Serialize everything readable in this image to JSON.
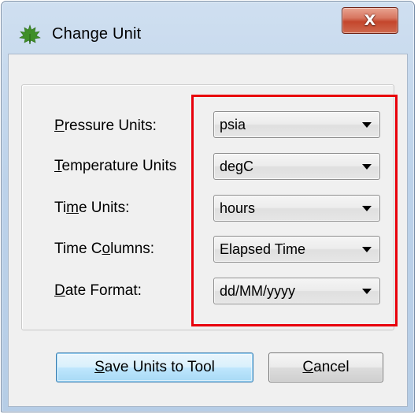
{
  "window": {
    "title": "Change Unit",
    "close_symbol": "X",
    "app_icon": "leaf-icon"
  },
  "fields": [
    {
      "label_mnemonic": "P",
      "label_rest": "ressure Units:",
      "value": "psia"
    },
    {
      "label_mnemonic": "T",
      "label_rest": "emperature Units",
      "value": "degC"
    },
    {
      "label_pre": "Ti",
      "label_mnemonic": "m",
      "label_rest": "e Units:",
      "value": "hours"
    },
    {
      "label_pre": "Time C",
      "label_mnemonic": "o",
      "label_rest": "lumns:",
      "value": "Elapsed Time"
    },
    {
      "label_mnemonic": "D",
      "label_rest": "ate Format:",
      "value": "dd/MM/yyyy"
    }
  ],
  "buttons": {
    "save": {
      "mnemonic": "S",
      "rest": "ave Units to Tool"
    },
    "cancel": {
      "mnemonic": "C",
      "rest": "ancel"
    }
  },
  "colors": {
    "highlight_border": "#e8000b",
    "close_button": "#c4462c"
  }
}
